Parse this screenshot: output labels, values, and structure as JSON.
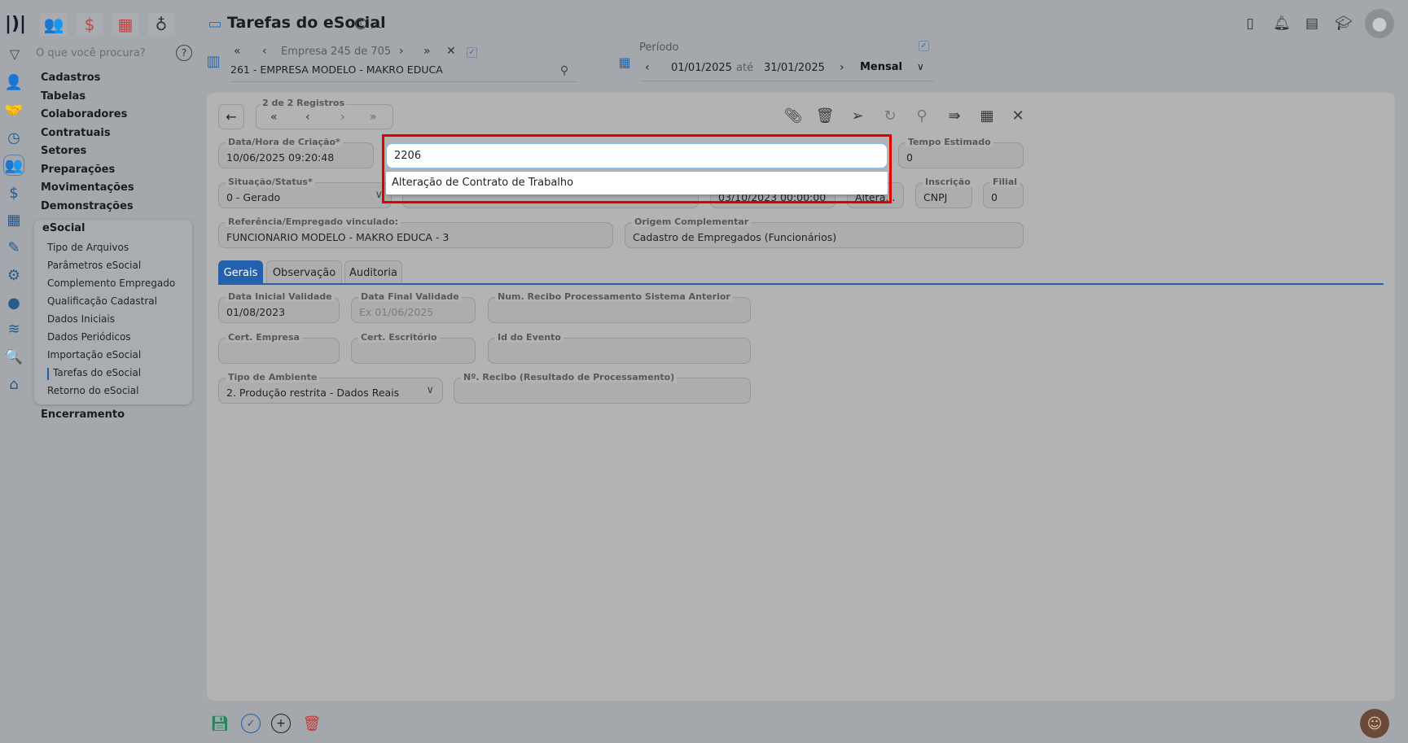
{
  "header": {
    "title": "Tarefas do eSocial",
    "info_icon": "info-icon",
    "collapse_icon": "chevron-up-icon"
  },
  "top_icons": [
    "users-icon",
    "dollar-icon",
    "calculator-icon",
    "money-bag-icon"
  ],
  "right_icons": [
    "document-icon",
    "bell-icon",
    "report-search-icon",
    "graduation-cap-icon",
    "user-avatar"
  ],
  "search": {
    "placeholder": "O que você procura?"
  },
  "sidebar": {
    "items": [
      "Cadastros",
      "Tabelas",
      "Colaboradores",
      "Contratuais",
      "Setores",
      "Preparações",
      "Movimentações",
      "Demonstrações"
    ],
    "submenu_title": "eSocial",
    "submenu": [
      "Tipo de Arquivos",
      "Parâmetros eSocial",
      "Complemento Empregado",
      "Qualificação Cadastral",
      "Dados Iniciais",
      "Dados Periódicos",
      "Importação eSocial",
      "Tarefas do eSocial",
      "Retorno do eSocial"
    ],
    "active_sub": "Tarefas do eSocial",
    "last": "Encerramento"
  },
  "company": {
    "nav_label": "Empresa 245 de 705",
    "name": "261 - EMPRESA MODELO - MAKRO EDUCA"
  },
  "period": {
    "label": "Período",
    "from": "01/01/2025",
    "sep": "até",
    "to": "31/01/2025",
    "mode": "Mensal"
  },
  "records": {
    "label": "2 de 2 Registros"
  },
  "form": {
    "data_hora_label": "Data/Hora de Criação*",
    "data_hora": "10/06/2025 09:20:48",
    "tipo_arquivo_value": "2206",
    "tipo_arquivo_option": "Alteração de Contrato de Trabalho",
    "tempo_label": "Tempo Estimado",
    "tempo": "0",
    "situacao_label": "Situação/Status*",
    "situacao": "0 - Gerado",
    "date2": "03/10/2023 00:00:00",
    "altera": "Altera...",
    "inscricao_label": "Inscrição",
    "inscricao": "CNPJ",
    "filial_label": "Filial",
    "filial": "0",
    "ref_label": "Referência/Empregado vinculado:",
    "ref": "FUNCIONARIO MODELO - MAKRO EDUCA - 3",
    "origem_label": "Origem Complementar",
    "origem": "Cadastro de Empregados (Funcionários)"
  },
  "tabs": [
    "Gerais",
    "Observação",
    "Auditoria"
  ],
  "gerais": {
    "data_ini_label": "Data Inicial Validade",
    "data_ini": "01/08/2023",
    "data_fim_label": "Data Final Validade",
    "data_fim_placeholder": "Ex 01/06/2025",
    "num_recibo_ant_label": "Num. Recibo Processamento Sistema Anterior",
    "cert_empresa_label": "Cert. Empresa",
    "cert_escritorio_label": "Cert. Escritório",
    "id_evento_label": "Id do Evento",
    "ambiente_label": "Tipo de Ambiente",
    "ambiente": "2. Produção restrita - Dados Reais",
    "num_recibo_label": "Nº. Recibo (Resultado de Processamento)"
  },
  "colors": {
    "highlight": "#e00000",
    "accent": "#1f5fae",
    "sidebar_icon": "#275a8d"
  }
}
